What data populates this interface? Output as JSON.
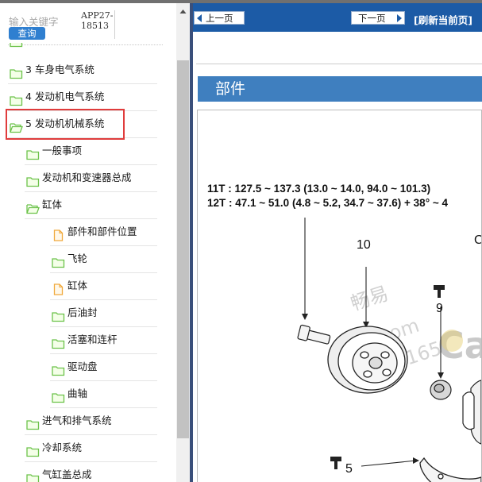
{
  "search": {
    "hint": "输入关键字",
    "button_label": "查询",
    "app_id": "APP27-18513"
  },
  "tree": [
    {
      "label": "3 车身电气系统",
      "level": 0,
      "icon": "folder-icon"
    },
    {
      "label": "4 发动机电气系统",
      "level": 0,
      "icon": "folder-icon"
    },
    {
      "label": "5 发动机机械系统",
      "level": 0,
      "icon": "folder-open-icon",
      "selected": true
    },
    {
      "label": "一般事项",
      "level": 1,
      "icon": "folder-icon"
    },
    {
      "label": "发动机和变速器总成",
      "level": 1,
      "icon": "folder-icon"
    },
    {
      "label": "缸体",
      "level": 1,
      "icon": "folder-open-icon"
    },
    {
      "label": "部件和部件位置",
      "level": 2,
      "icon": "document-icon"
    },
    {
      "label": "飞轮",
      "level": 2,
      "icon": "folder-icon"
    },
    {
      "label": "缸体",
      "level": 2,
      "icon": "document-icon"
    },
    {
      "label": "后油封",
      "level": 2,
      "icon": "folder-icon"
    },
    {
      "label": "活塞和连杆",
      "level": 2,
      "icon": "folder-icon"
    },
    {
      "label": "驱动盘",
      "level": 2,
      "icon": "folder-icon"
    },
    {
      "label": "曲轴",
      "level": 2,
      "icon": "folder-icon"
    },
    {
      "label": "进气和排气系统",
      "level": 1,
      "icon": "folder-icon"
    },
    {
      "label": "冷却系统",
      "level": 1,
      "icon": "folder-icon"
    },
    {
      "label": "气缸盖总成",
      "level": 1,
      "icon": "folder-icon"
    }
  ],
  "toolbar": {
    "prev_label": "上一页",
    "next_label": "下一页",
    "refresh_label": "[刷新当前页]"
  },
  "content": {
    "section_title": "部件",
    "figure": {
      "spec_line_1": "11T : 127.5 ~ 137.3 (13.0 ~ 14.0, 94.0 ~ 101.3)",
      "spec_line_2": "12T : 47.1 ~ 51.0 (4.8 ~ 5.2, 34.7 ~ 37.6) + 38° ~ 4",
      "callout_10": "10",
      "callout_9": "9",
      "callout_5": "5",
      "callout_partial": "C",
      "watermark_1": "畅易",
      "watermark_2": "o8.com",
      "watermark_3": "20165",
      "watermark_4": "Ca"
    }
  },
  "colors": {
    "toolbar": "#1c5ba6",
    "section_bar": "#3f7fbf",
    "highlight": "#e03c3c",
    "folder": "#6cc24a",
    "document": "#f0a93c",
    "search_button": "#2f7fd0"
  }
}
